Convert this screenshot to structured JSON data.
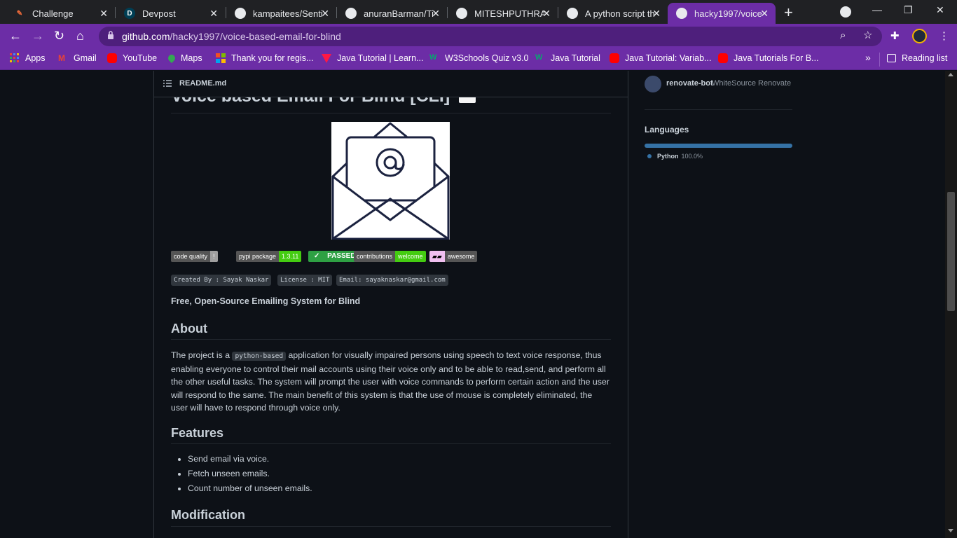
{
  "browser": {
    "tabs": [
      {
        "title": "Challenge",
        "icon": "challenge-icon",
        "active": false
      },
      {
        "title": "Devpost",
        "icon": "devpost-icon",
        "active": false
      },
      {
        "title": "kampaitees/Senti",
        "icon": "github-icon",
        "active": false
      },
      {
        "title": "anuranBarman/Ti",
        "icon": "github-icon",
        "active": false
      },
      {
        "title": "MITESHPUTHRAN",
        "icon": "github-icon",
        "active": false
      },
      {
        "title": "A python script th",
        "icon": "github-icon",
        "active": false
      },
      {
        "title": "hacky1997/voice",
        "icon": "github-icon",
        "active": true
      }
    ],
    "url_host": "github.com",
    "url_path": "/hacky1997/voice-based-email-for-blind",
    "bookmarks": [
      "Apps",
      "Gmail",
      "YouTube",
      "Maps",
      "Thank you for regis...",
      "Java Tutorial | Learn...",
      "W3Schools Quiz v3.0",
      "Java Tutorial",
      "Java Tutorial: Variab...",
      "Java Tutorials For B..."
    ],
    "reading_list": "Reading list",
    "theme_color": "#6c2da6"
  },
  "readme": {
    "filename": "README.md",
    "title": "Voice based Email For Blind [CLI]",
    "badges": [
      {
        "left": "code quality",
        "right": "!",
        "left_color": "#555555",
        "right_color": "#9f9f9f"
      },
      {
        "left": "pypi package",
        "right": "1.3.11",
        "left_color": "#555555",
        "right_color": "#4c1"
      },
      {
        "left": "",
        "right": "PASSED",
        "left_color": "#2ea043",
        "right_color": "#2ea043"
      },
      {
        "left": "contributions",
        "right": "welcome",
        "left_color": "#555555",
        "right_color": "#4c1"
      },
      {
        "left": "",
        "right": "awesome",
        "left_color": "#f0c0f0",
        "right_color": "#555555"
      }
    ],
    "meta_tags": [
      "Created By : Sayak Naskar",
      "License : MIT",
      "Email: sayaknaskar@gmail.com"
    ],
    "tagline": "Free, Open-Source Emailing System for Blind",
    "about_heading": "About",
    "about_before_code": "The project is a ",
    "about_code": "python-based",
    "about_after_code": " application for visually impaired persons using speech to text voice response, thus enabling everyone to control their mail accounts using their voice only and to be able to read,send, and perform all the other useful tasks. The system will prompt the user with voice commands to perform certain action and the user will respond to the same. The main benefit of this system is that the use of mouse is completely eliminated, the user will have to respond through voice only.",
    "features_heading": "Features",
    "features": [
      "Send email via voice.",
      "Fetch unseen emails.",
      "Count number of unseen emails."
    ],
    "modification_heading": "Modification"
  },
  "sidebar": {
    "contributor_name": "renovate-bot",
    "contributor_desc": "WhiteSource Renovate",
    "languages_title": "Languages",
    "languages": [
      {
        "name": "Python",
        "percent": "100.0%",
        "color": "#3572a5"
      }
    ]
  }
}
